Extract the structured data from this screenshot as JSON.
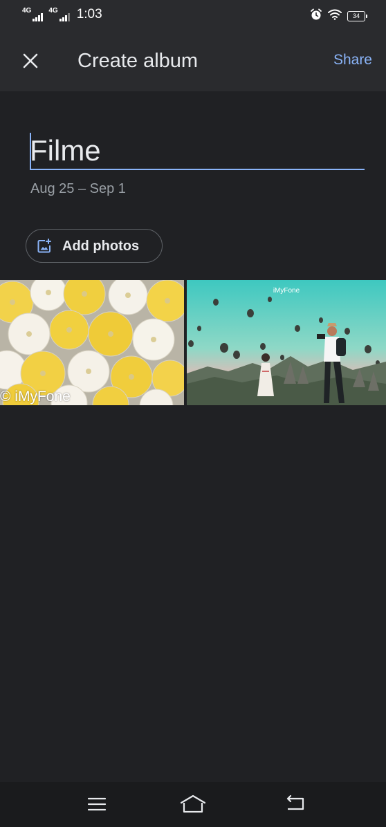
{
  "status_bar": {
    "network_1": "4G",
    "network_2": "4G",
    "time": "1:03",
    "battery": "34",
    "icons": [
      "alarm-icon",
      "wifi-icon",
      "battery-icon"
    ]
  },
  "app_bar": {
    "close_icon": "close-icon",
    "title": "Create album",
    "share_label": "Share"
  },
  "album": {
    "title_value": "Filme",
    "date_range": "Aug 25 – Sep 1"
  },
  "add_photos": {
    "icon": "add-photo-icon",
    "label": "Add photos"
  },
  "photos": [
    {
      "description_icon": "photo-thumbnail",
      "watermark": "© iMyFone"
    },
    {
      "description_icon": "photo-thumbnail",
      "watermark": "iMyFone"
    }
  ],
  "nav_bar": {
    "icons": [
      "menu-icon",
      "home-icon",
      "back-icon"
    ]
  },
  "colors": {
    "background": "#202124",
    "bar": "#2a2b2e",
    "accent": "#8ab4f8",
    "text_primary": "#e8eaed",
    "text_secondary": "#9aa0a6"
  }
}
